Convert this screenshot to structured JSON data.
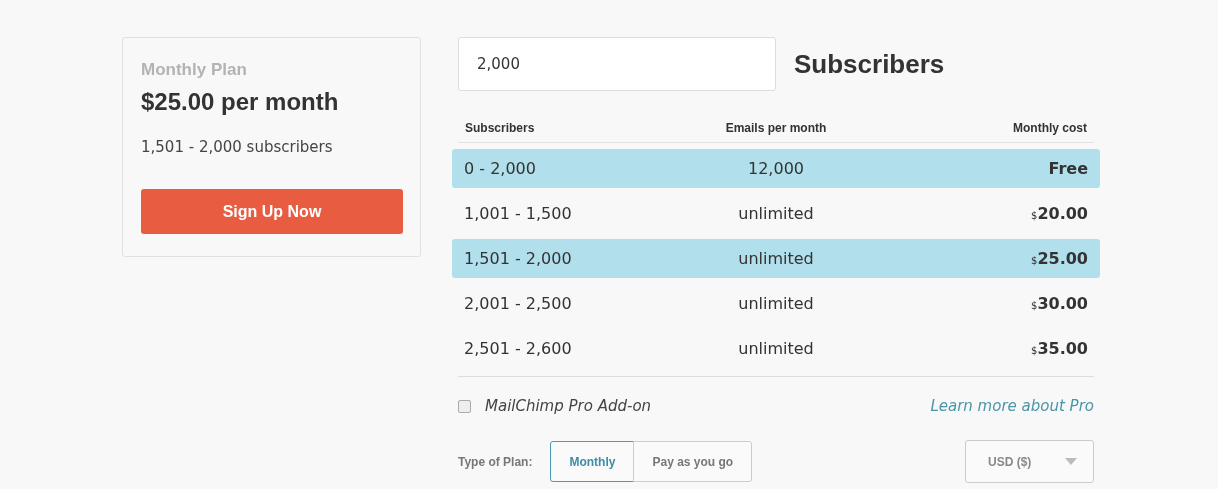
{
  "plan_card": {
    "title": "Monthly Plan",
    "price": "$25.00 per month",
    "range": "1,501 - 2,000 subscribers",
    "button": "Sign Up Now"
  },
  "subscribers_field": {
    "value": "2,000",
    "label": "Subscribers"
  },
  "table": {
    "columns": [
      "Subscribers",
      "Emails per month",
      "Monthly cost"
    ],
    "rows": [
      {
        "range": "0 - 2,000",
        "emails": "12,000",
        "currency": "",
        "cost": "Free",
        "highlighted": true
      },
      {
        "range": "1,001 - 1,500",
        "emails": "unlimited",
        "currency": "$",
        "cost": "20.00",
        "highlighted": false
      },
      {
        "range": "1,501 - 2,000",
        "emails": "unlimited",
        "currency": "$",
        "cost": "25.00",
        "highlighted": true
      },
      {
        "range": "2,001 - 2,500",
        "emails": "unlimited",
        "currency": "$",
        "cost": "30.00",
        "highlighted": false
      },
      {
        "range": "2,501 - 2,600",
        "emails": "unlimited",
        "currency": "$",
        "cost": "35.00",
        "highlighted": false
      }
    ]
  },
  "pro_addon": {
    "label": "MailChimp Pro Add-on",
    "checked": false,
    "link": "Learn more about Pro"
  },
  "plan_type": {
    "label": "Type of Plan:",
    "options": [
      {
        "label": "Monthly",
        "selected": true
      },
      {
        "label": "Pay as you go",
        "selected": false
      }
    ]
  },
  "currency_select": {
    "value": "USD ($)"
  }
}
